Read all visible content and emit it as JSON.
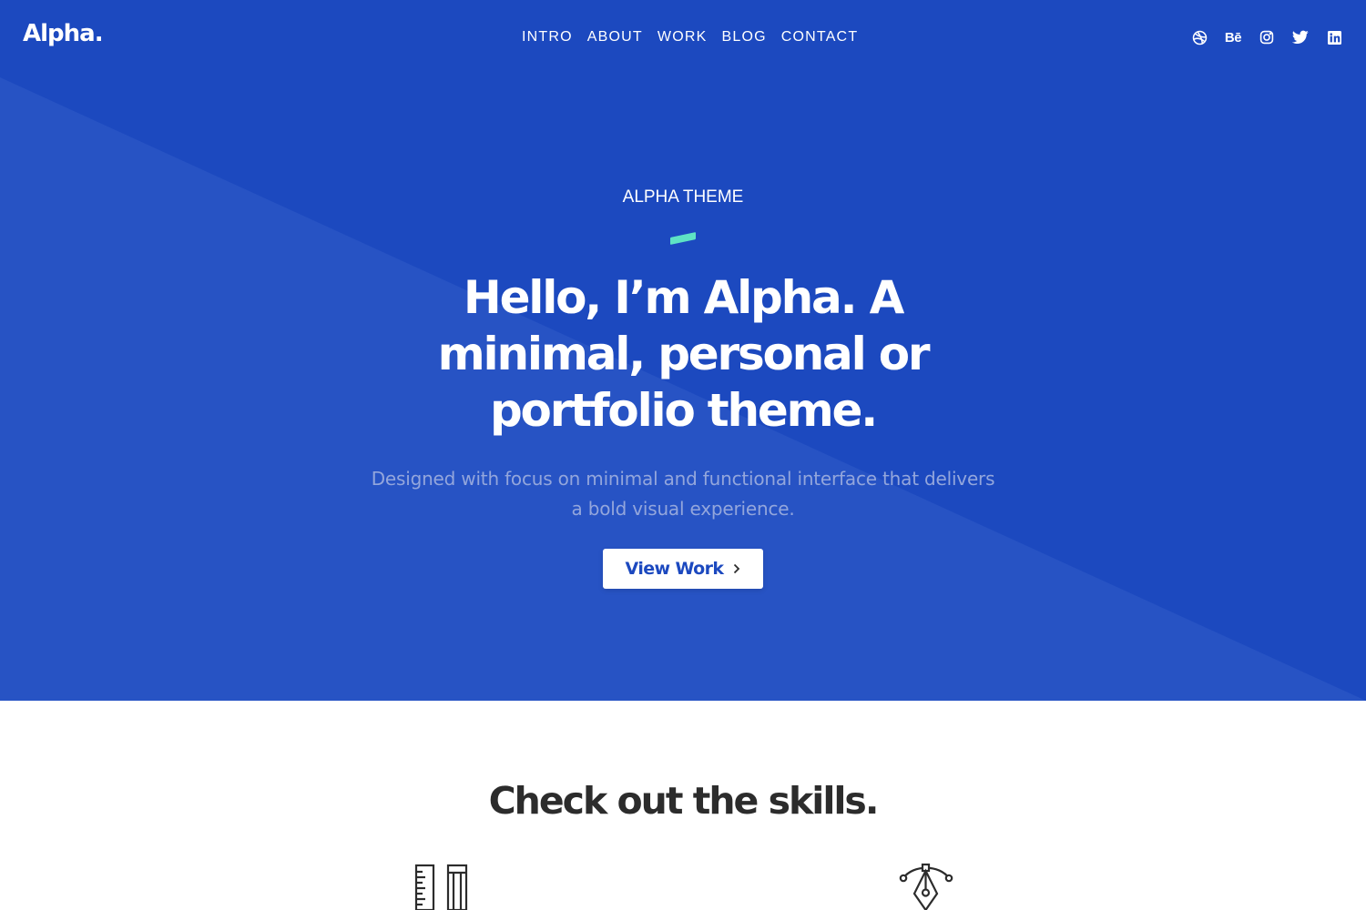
{
  "header": {
    "logo": "Alpha.",
    "nav": [
      "INTRO",
      "ABOUT",
      "WORK",
      "BLOG",
      "CONTACT"
    ],
    "social": [
      {
        "icon": "dribbble-icon"
      },
      {
        "icon": "behance-icon",
        "text": "Bē"
      },
      {
        "icon": "instagram-icon"
      },
      {
        "icon": "twitter-icon"
      },
      {
        "icon": "linkedin-icon"
      }
    ]
  },
  "hero": {
    "eyebrow": "ALPHA THEME",
    "headline": "Hello, I’m Alpha. A minimal, personal or portfolio theme.",
    "subtext": "Designed with focus on minimal and functional interface that delivers a bold visual experience.",
    "cta_label": "View Work",
    "cta_icon": "chevron-right-icon"
  },
  "skills": {
    "title": "Check out the skills.",
    "icons": [
      "ruler-pencil-icon",
      "pen-tool-icon"
    ]
  },
  "colors": {
    "hero_bg": "#1c49bf",
    "hero_diagonal": "#2753c4",
    "accent": "#5ee3c4",
    "subtext": "#93a6dc",
    "heading_dark": "#2c2c2c"
  }
}
